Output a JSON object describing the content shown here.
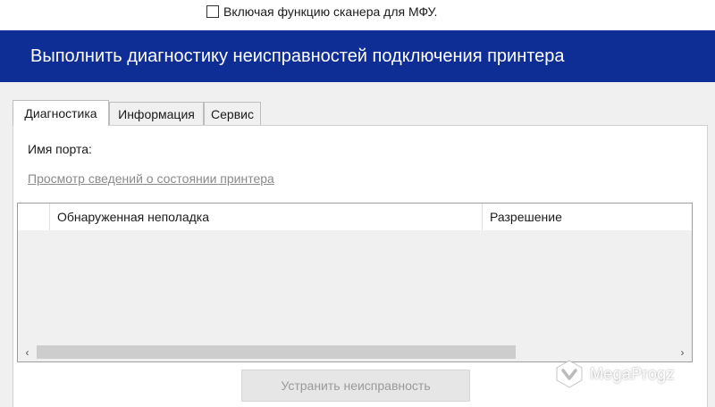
{
  "top_option": {
    "checked": false,
    "label": "Включая функцию сканера для МФУ."
  },
  "banner": {
    "title": "Выполнить диагностику неисправностей подключения принтера",
    "color": "#0f2e95"
  },
  "tabs": [
    {
      "label": "Диагностика",
      "active": true
    },
    {
      "label": "Информация",
      "active": false
    },
    {
      "label": "Сервис",
      "active": false
    }
  ],
  "panel": {
    "port_label": "Имя порта:",
    "status_link": "Просмотр сведений о состоянии принтера"
  },
  "list": {
    "columns": [
      "",
      "Обнаруженная неполадка",
      "Разрешение"
    ],
    "rows": []
  },
  "scrollbar": {
    "left_arrow": "‹",
    "right_arrow": "›"
  },
  "actions": {
    "fix_label": "Устранить неисправность"
  },
  "watermark": {
    "text": "MegaProgz",
    "icon": "megaprogz-logo-icon"
  }
}
